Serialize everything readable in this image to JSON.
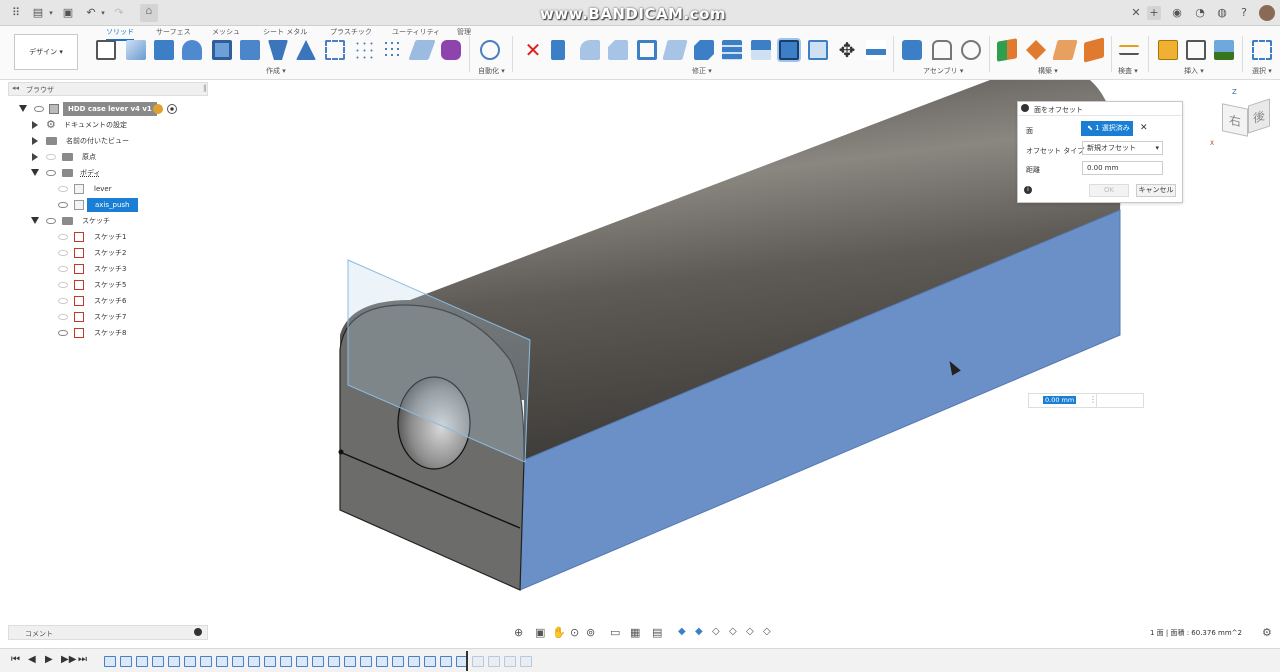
{
  "watermark": "www.BANDICAM.com",
  "tabs": [
    {
      "label": "ソリッド",
      "active": true
    },
    {
      "label": "サーフェス",
      "active": false
    },
    {
      "label": "メッシュ",
      "active": false
    },
    {
      "label": "シート メタル",
      "active": false
    },
    {
      "label": "プラスチック",
      "active": false
    },
    {
      "label": "ユーティリティ",
      "active": false
    },
    {
      "label": "管理",
      "active": false
    }
  ],
  "workspace": "デザイン",
  "groups": {
    "create": "作成",
    "automate": "自動化",
    "modify": "修正",
    "assemble": "アセンブリ",
    "construct": "構築",
    "inspect": "検査",
    "insert": "挿入",
    "select": "選択"
  },
  "browser": {
    "title": "ブラウザ",
    "root": "HDD case lever v4 v1",
    "items": {
      "doc_settings": "ドキュメントの設定",
      "named_views": "名前の付いたビュー",
      "origin": "原点",
      "bodies": "ボディ",
      "body1": "lever",
      "body2": "axis_push",
      "sketches": "スケッチ",
      "sketch_list": [
        "スケッチ1",
        "スケッチ2",
        "スケッチ3",
        "スケッチ5",
        "スケッチ6",
        "スケッチ7",
        "スケッチ8"
      ]
    }
  },
  "dialog": {
    "title": "面をオフセット",
    "face_label": "面",
    "face_value": "1 選択済み",
    "type_label": "オフセット タイプ",
    "type_value": "新規オフセット",
    "distance_label": "距離",
    "distance_value": "0.00 mm",
    "ok": "OK",
    "cancel": "キャンセル"
  },
  "viewcube": {
    "front": "右",
    "back": "後"
  },
  "inline_input": "0.00 mm",
  "comments": "コメント",
  "status": "1 面 | 面積 : 60.376 mm^2",
  "colors": {
    "accent": "#1a7fd4",
    "selected_face": "#6b8fc7",
    "body": "#7a7670"
  }
}
